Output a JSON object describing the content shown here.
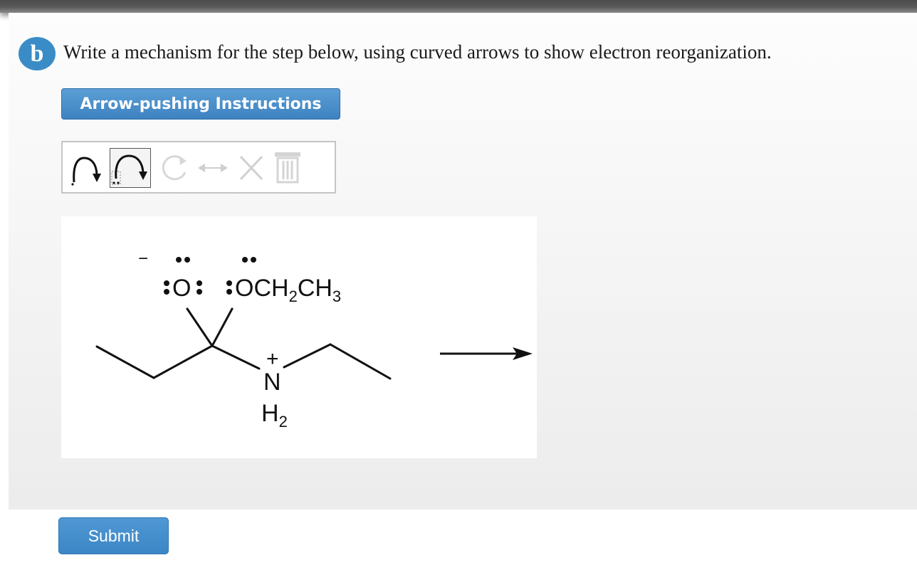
{
  "question": {
    "part_label": "b",
    "text": "Write a mechanism for the step below, using curved arrows to show electron reorganization."
  },
  "buttons": {
    "instructions_label": "Arrow-pushing Instructions",
    "submit_label": "Submit"
  },
  "toolbar": {
    "tools": [
      {
        "name": "curved-arrow-icon",
        "state": "enabled"
      },
      {
        "name": "curved-arrow-lone-pair-icon",
        "state": "enabled"
      },
      {
        "name": "rotate-icon",
        "state": "disabled"
      },
      {
        "name": "double-arrow-icon",
        "state": "disabled"
      },
      {
        "name": "delete-x-icon",
        "state": "disabled"
      },
      {
        "name": "trash-icon",
        "state": "disabled"
      }
    ]
  },
  "molecule": {
    "oxyanion_charge": "−",
    "oxygen_label": "O",
    "ethoxy_label": "OCH",
    "ethoxy_sub1": "2",
    "ethoxy_ch": "CH",
    "ethoxy_sub2": "3",
    "nitrogen_label": "N",
    "nitrogen_charge": "+",
    "nh_label": "H",
    "nh_sub": "2"
  },
  "colors": {
    "accent": "#3a8cc6",
    "button": "#4189c8",
    "text": "#1a1a1a"
  }
}
